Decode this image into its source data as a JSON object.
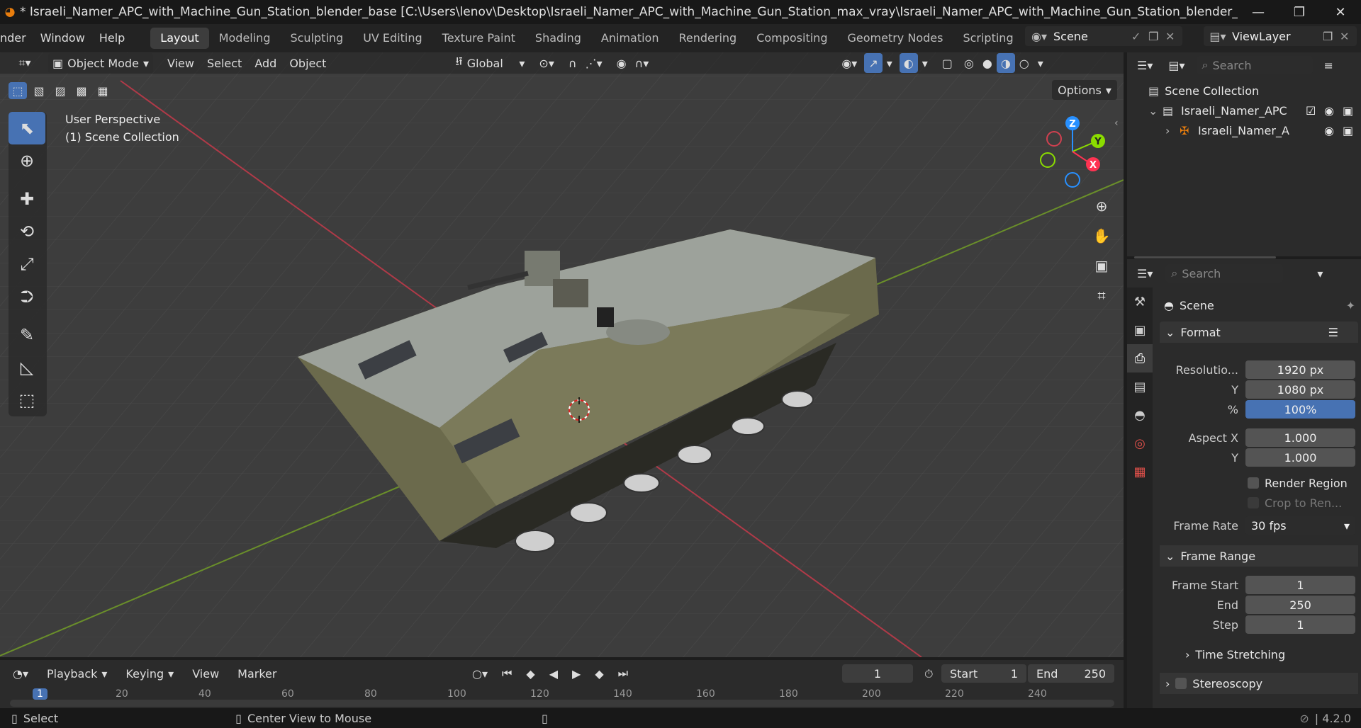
{
  "title": "* Israeli_Namer_APC_with_Machine_Gun_Station_blender_base [C:\\Users\\lenov\\Desktop\\Israeli_Namer_APC_with_Machine_Gun_Station_max_vray\\Israeli_Namer_APC_with_Machine_Gun_Station_blender_base.blend] - Blender ...",
  "menus": [
    "nder",
    "Window",
    "Help"
  ],
  "workspaces": [
    "Layout",
    "Modeling",
    "Sculpting",
    "UV Editing",
    "Texture Paint",
    "Shading",
    "Animation",
    "Rendering",
    "Compositing",
    "Geometry Nodes",
    "Scripting"
  ],
  "active_workspace": "Layout",
  "scene_name": "Scene",
  "view_layer": "ViewLayer",
  "viewport": {
    "mode": "Object Mode",
    "menus": [
      "View",
      "Select",
      "Add",
      "Object"
    ],
    "transform_orientation": "Global",
    "options_label": "Options",
    "perspective_label": "User Perspective",
    "collection_label": "(1) Scene Collection",
    "gizmo": {
      "z": "Z",
      "y": "Y",
      "x": "X"
    }
  },
  "outliner": {
    "search_placeholder": "Search",
    "root": "Scene Collection",
    "items": [
      {
        "label": "Israeli_Namer_APC",
        "level": 1
      },
      {
        "label": "Israeli_Namer_A",
        "level": 2
      }
    ]
  },
  "properties": {
    "search_placeholder": "Search",
    "context": "Scene",
    "panels": {
      "format": {
        "title": "Format",
        "resolution_label": "Resolutio...",
        "res_x": "1920 px",
        "y_label": "Y",
        "res_y": "1080 px",
        "pct_label": "%",
        "pct": "100%",
        "aspect_x_label": "Aspect X",
        "aspect_x": "1.000",
        "aspect_y_label": "Y",
        "aspect_y": "1.000",
        "render_region": "Render Region",
        "crop": "Crop to Ren...",
        "frame_rate_label": "Frame Rate",
        "frame_rate": "30 fps"
      },
      "frame_range": {
        "title": "Frame Range",
        "start_label": "Frame Start",
        "start": "1",
        "end_label": "End",
        "end": "250",
        "step_label": "Step",
        "step": "1"
      },
      "time_stretching": "Time Stretching",
      "stereoscopy": "Stereoscopy"
    }
  },
  "timeline": {
    "menus": [
      "Playback",
      "Keying",
      "View",
      "Marker"
    ],
    "current_frame": "1",
    "start_label": "Start",
    "start": "1",
    "end_label": "End",
    "end": "250",
    "ruler": [
      "1",
      "20",
      "40",
      "60",
      "80",
      "100",
      "120",
      "140",
      "160",
      "180",
      "200",
      "220",
      "240"
    ]
  },
  "status": {
    "select": "Select",
    "center_view": "Center View to Mouse",
    "version": "4.2.0"
  },
  "colors": {
    "accent": "#4772b3",
    "x_axis": "#ff3352",
    "y_axis": "#8bdc00",
    "z_axis": "#2890ff",
    "orange": "#e87d0d"
  }
}
